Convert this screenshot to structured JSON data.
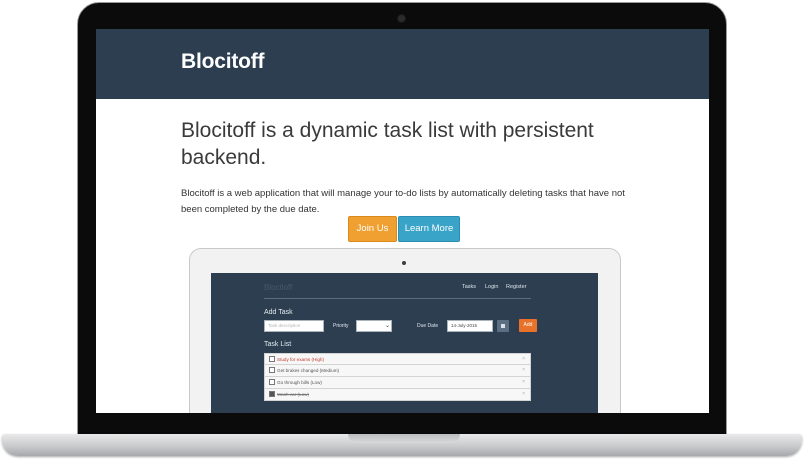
{
  "page": {
    "brand": "Blocitoff",
    "headline": "Blocitoff is a dynamic task list with persistent backend.",
    "lead": "Blocitoff is a web application that will manage your to-do lists by automatically deleting tasks that have not been completed by the due date.",
    "join_label": "Join Us",
    "learn_label": "Learn More"
  },
  "preview": {
    "brand": "Blocitoff",
    "nav": [
      "Tasks",
      "Login",
      "Register"
    ],
    "add_task_heading": "Add Task",
    "task_placeholder": "Task description",
    "priority_label": "Priority",
    "due_date_label": "Due Date",
    "due_date_value": "14-July-2015",
    "add_label": "Add",
    "task_list_heading": "Task List",
    "tasks": [
      {
        "text": "Study for exams (High)",
        "style": "red"
      },
      {
        "text": "Get brakes changed (Medium)",
        "style": "normal"
      },
      {
        "text": "Go through bills (Low)",
        "style": "normal"
      },
      {
        "text": "Wash car (Low)",
        "style": "done"
      }
    ],
    "delete_glyph": "×"
  },
  "colors": {
    "navbar": "#2c3e50",
    "join_button": "#f0a030",
    "learn_button": "#3aa3c8",
    "add_button": "#e8722a"
  }
}
